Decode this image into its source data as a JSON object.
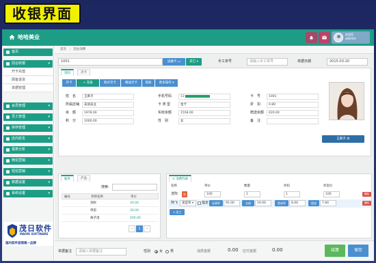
{
  "banner": {
    "title": "收银界面"
  },
  "topbar": {
    "brand": "哈哈美业",
    "welcome": "欢迎您",
    "user": "admin"
  },
  "sidebar": {
    "items": [
      {
        "label": "首页"
      },
      {
        "label": "前台收银",
        "chev": "▾"
      },
      {
        "label": "会员管理",
        "chev": "▾"
      },
      {
        "label": "员工管理",
        "chev": "▾"
      },
      {
        "label": "库存管理",
        "chev": "▾"
      },
      {
        "label": "店内收支",
        "chev": "▾"
      },
      {
        "label": "报表分析",
        "chev": "▾"
      },
      {
        "label": "微信营销",
        "chev": "▾"
      },
      {
        "label": "短信营销",
        "chev": "▾"
      },
      {
        "label": "数据设置",
        "chev": "▾"
      },
      {
        "label": "系统设置",
        "chev": "▾"
      }
    ],
    "subitems": [
      "开卡充值",
      "顾客退货",
      "单据管理"
    ]
  },
  "logo": {
    "title": "茂日软件",
    "en": "MAORI SOFTWARE",
    "slogan": "国内软件首销第一品牌"
  },
  "crumb": {
    "home": "首页",
    "current": "前台消费"
  },
  "search": {
    "card": "1001",
    "read_card": "读磁卡",
    "other": "其它",
    "manual_label": "手工单号",
    "manual_placeholder": "请输入手工单号",
    "date_label": "单据日期",
    "date": "2015-03-20"
  },
  "member": {
    "tabs": [
      "资料",
      "次卡"
    ],
    "tools": [
      "开卡",
      "充值",
      "购买次卡",
      "赠送次卡",
      "取款",
      "更多操作"
    ],
    "rows": [
      [
        {
          "k": "姓　名",
          "v": "王麻子"
        },
        {
          "k": "手机号码",
          "v": "13"
        },
        {
          "k": "卡　号",
          "v": "1001"
        }
      ],
      [
        {
          "k": "所属店铺",
          "v": "美丽美业"
        },
        {
          "k": "卡 类 型",
          "v": "金卡"
        },
        {
          "k": "折　扣",
          "v": "0.80"
        }
      ],
      [
        {
          "k": "余　额",
          "v": "1978.00"
        },
        {
          "k": "实收余额",
          "v": "1558.00"
        },
        {
          "k": "赠送余额",
          "v": "420.00"
        }
      ],
      [
        {
          "k": "积　分",
          "v": "1000.00"
        },
        {
          "k": "性　别",
          "v": "女"
        },
        {
          "k": "备　注",
          "v": ""
        }
      ]
    ],
    "photo_caption": "王麻子-女"
  },
  "services": {
    "tabs": [
      "服务",
      "产品"
    ],
    "search_label": "搜索:",
    "columns": [
      "编号",
      "项目名称",
      "单价"
    ],
    "rows": [
      {
        "name": "洗吹",
        "price": "20.00"
      },
      {
        "name": "单剪",
        "price": "30.00"
      },
      {
        "name": "离子烫",
        "price": "200.00"
      }
    ],
    "page": "1"
  },
  "consumption": {
    "title": "消费列表",
    "columns": [
      "名称",
      "单价",
      "数量",
      "折扣",
      "折后价"
    ],
    "item": {
      "name": "洗吹",
      "badge": "次",
      "price": "100",
      "qty": "1",
      "discount": "1",
      "final": "100",
      "delete": "删除"
    },
    "staff": {
      "label": "阿飞",
      "select": "发型师",
      "appoint": "指定",
      "perf_label": "业绩率",
      "perf": "95.00",
      "amount_label": "业绩",
      "amount": "19.00",
      "comm_rate_label": "提成率",
      "comm_rate": "8.00",
      "comm_label": "提成",
      "comm": "7.84",
      "delete": "删除"
    },
    "add_staff": "+ 员工"
  },
  "footer": {
    "note_label": "单据备注",
    "note_placeholder": "请输入单据备注",
    "gender_label": "性别",
    "female": "女",
    "male": "男",
    "total_label": "消费金额",
    "total": "0.00",
    "paid_label": "应付金额",
    "paid": "0.00",
    "settle": "结算",
    "save": "保存"
  },
  "colors": {
    "primary": "#1d9d86",
    "blue": "#4a8fd0",
    "red": "#d9534f",
    "banner": "#f0f000"
  }
}
